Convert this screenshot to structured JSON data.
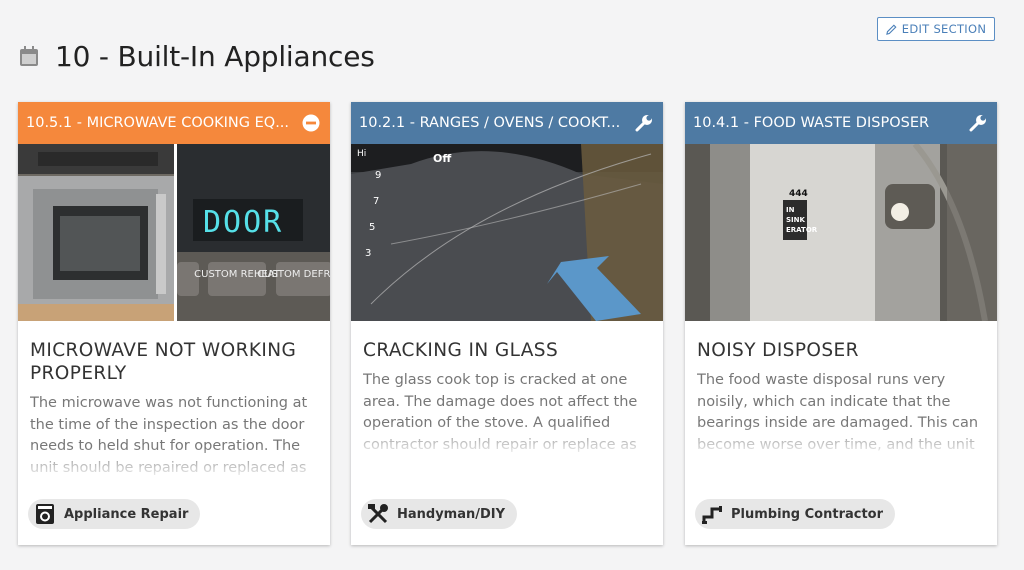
{
  "section": {
    "title": "10 - Built-In Appliances",
    "edit_label": "EDIT SECTION"
  },
  "colors": {
    "orange_header": "#f5883c",
    "blue_header": "#4e7aa3",
    "arrow_blue": "#5b97c9"
  },
  "cards": [
    {
      "header": "10.5.1 - MICROWAVE COOKING EQ...",
      "header_icon": "minus-circle-icon",
      "title": "MICROWAVE NOT WORKING PROPERLY",
      "description": "The microwave was not functioning at the time of the inspection as the door needs to held shut for operation.  The unit should be repaired or replaced as",
      "display_text": "DOOR",
      "button_labels": [
        "CUSTOM REHEAT",
        "CUSTOM DEFROST"
      ],
      "pill": {
        "label": "Appliance Repair",
        "icon": "washing-machine-icon"
      }
    },
    {
      "header": "10.2.1 - RANGES / OVENS / COOKT...",
      "header_icon": "wrench-icon",
      "title": "CRACKING IN GLASS",
      "description": "The glass cook top is cracked at one area.  The damage does not affect the operation of the stove.  A qualified contractor should repair or replace as desired.",
      "knob_labels": [
        "Hi",
        "Off",
        "9",
        "7",
        "5",
        "3"
      ],
      "pill": {
        "label": "Handyman/DIY",
        "icon": "tools-icon"
      }
    },
    {
      "header": "10.4.1 - FOOD WASTE DISPOSER",
      "header_icon": "wrench-icon",
      "title": "NOISY DISPOSER",
      "description": "The food waste disposal runs very noisily, which can indicate that the bearings inside are damaged. This can become worse over time, and the unit may eventually fail. A plumber should",
      "brand_text": [
        "444",
        "IN",
        "SINK",
        "ERATOR"
      ],
      "pill": {
        "label": "Plumbing Contractor",
        "icon": "pipe-icon"
      }
    }
  ]
}
